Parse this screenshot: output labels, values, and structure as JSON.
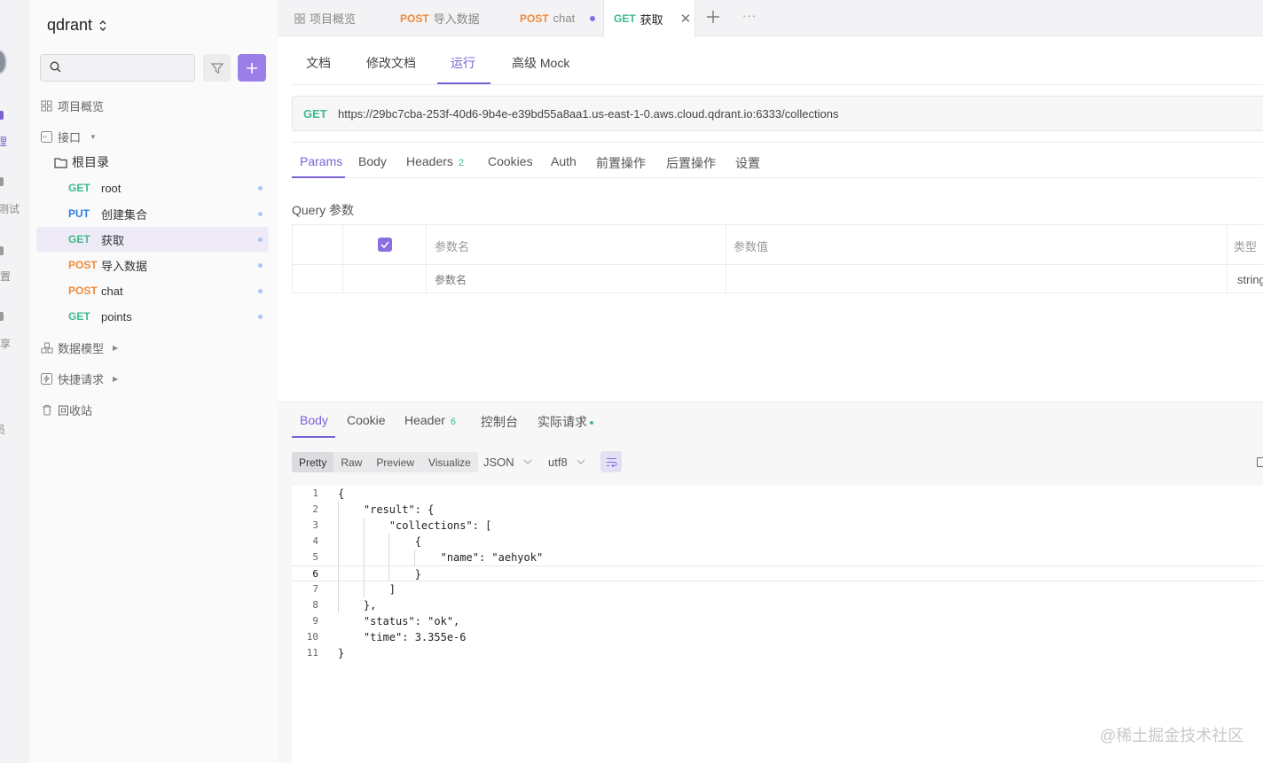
{
  "rail": {
    "items": [
      {
        "label": "理",
        "active": true
      },
      {
        "label": "测试",
        "active": false
      },
      {
        "label": "设置",
        "active": false
      },
      {
        "label": "分享",
        "active": false
      },
      {
        "label": "员",
        "active": false
      }
    ]
  },
  "sidebar": {
    "project_title": "qdrant",
    "search_placeholder": "",
    "nav": {
      "overview": "项目概览",
      "interfaces": "接口",
      "root_folder": "根目录",
      "data_models": "数据模型",
      "quick_requests": "快捷请求",
      "recycle_bin": "回收站"
    },
    "apis": [
      {
        "method": "GET",
        "name": "root"
      },
      {
        "method": "PUT",
        "name": "创建集合"
      },
      {
        "method": "GET",
        "name": "获取",
        "selected": true
      },
      {
        "method": "POST",
        "name": "导入数据"
      },
      {
        "method": "POST",
        "name": "chat"
      },
      {
        "method": "GET",
        "name": "points"
      }
    ]
  },
  "tabs": [
    {
      "method": "",
      "label": "项目概览"
    },
    {
      "method": "POST",
      "label": "导入数据"
    },
    {
      "method": "POST",
      "label": "chat",
      "unsaved": true
    },
    {
      "method": "GET",
      "label": "获取",
      "active": true
    }
  ],
  "subtabs": [
    "文档",
    "修改文档",
    "运行",
    "高级 Mock"
  ],
  "request": {
    "method": "GET",
    "url": "https://29bc7cba-253f-40d6-9b4e-e39bd55a8aa1.us-east-1-0.aws.cloud.qdrant.io:6333/collections"
  },
  "request_tabs": [
    {
      "label": "Params",
      "active": true
    },
    {
      "label": "Body"
    },
    {
      "label": "Headers",
      "count": "2"
    },
    {
      "label": "Cookies"
    },
    {
      "label": "Auth"
    },
    {
      "label": "前置操作"
    },
    {
      "label": "后置操作"
    },
    {
      "label": "设置"
    }
  ],
  "query": {
    "title": "Query 参数",
    "headers": {
      "name": "参数名",
      "value": "参数值",
      "type": "类型"
    },
    "row": {
      "name_placeholder": "参数名",
      "type": "string"
    }
  },
  "response": {
    "tabs": [
      {
        "label": "Body",
        "active": true
      },
      {
        "label": "Cookie"
      },
      {
        "label": "Header",
        "count": "6"
      },
      {
        "label": "控制台"
      },
      {
        "label": "实际请求"
      }
    ],
    "view_modes": [
      "Pretty",
      "Raw",
      "Preview",
      "Visualize"
    ],
    "active_view_mode": "Pretty",
    "format": "JSON",
    "encoding": "utf8",
    "code_lines": [
      "{",
      "    \"result\": {",
      "        \"collections\": [",
      "            {",
      "                \"name\": \"aehyok\"",
      "            }",
      "        ]",
      "    },",
      "    \"status\": \"ok\",",
      "    \"time\": 3.355e-6",
      "}"
    ],
    "current_line": 6
  },
  "watermark": "@稀土掘金技术社区",
  "colors": {
    "accent": "#7b61d4",
    "get": "#3dbb8a",
    "put": "#2f7fe0",
    "post": "#f08a3a"
  }
}
